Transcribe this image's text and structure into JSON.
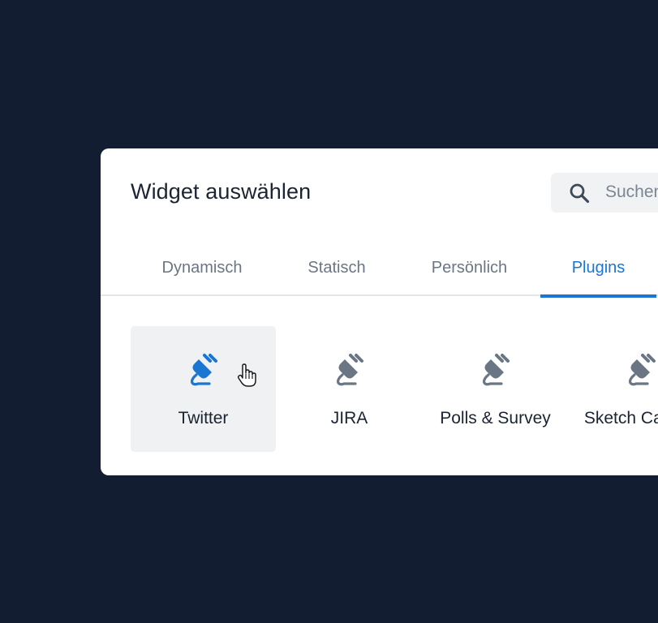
{
  "dialog": {
    "title": "Widget auswählen",
    "search": {
      "placeholder": "Suchen",
      "icon": "search-icon"
    },
    "tabs": [
      {
        "label": "Dynamisch",
        "active": false
      },
      {
        "label": "Statisch",
        "active": false
      },
      {
        "label": "Persönlich",
        "active": false
      },
      {
        "label": "Plugins",
        "active": true
      }
    ],
    "plugins": [
      {
        "label": "Twitter",
        "icon": "plug-icon",
        "hovered": true
      },
      {
        "label": "JIRA",
        "icon": "plug-icon",
        "hovered": false
      },
      {
        "label": "Polls & Survey",
        "icon": "plug-icon",
        "hovered": false
      },
      {
        "label": "Sketch Canvas",
        "icon": "plug-icon",
        "hovered": false
      }
    ]
  },
  "colors": {
    "background": "#121d31",
    "accent": "#1976d2",
    "icon_inactive": "#6a7684",
    "text": "#1a2433"
  }
}
